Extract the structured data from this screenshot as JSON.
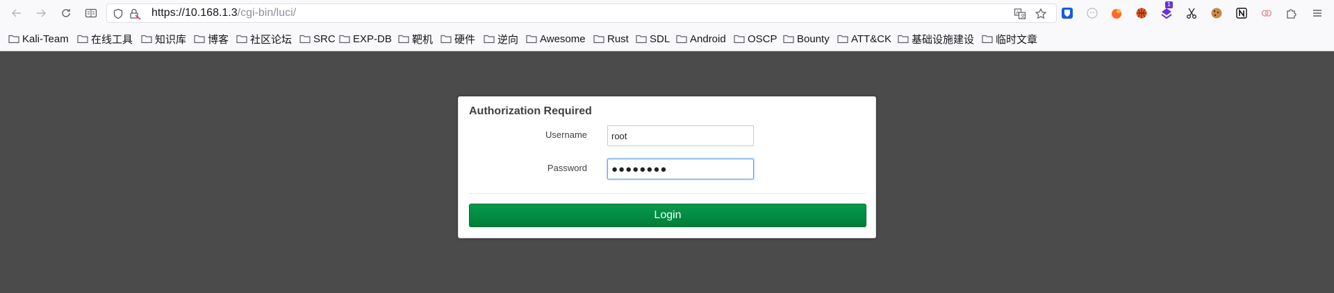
{
  "browser": {
    "url_host": "https://10.168.1.3",
    "url_path": "/cgi-bin/luci/",
    "extensions": [
      "bitwarden-icon",
      "ghost-extension-icon",
      "orange-extension-icon",
      "basketball-extension-icon",
      "pocket-extension-icon",
      "scissors-icon",
      "cookie-icon",
      "notion-icon",
      "link-extension-icon",
      "extensions-puzzle-icon",
      "menu-icon"
    ],
    "extension_badge": "1"
  },
  "bookmarks": [
    "Kali-Team",
    "在线工具",
    "知识库",
    "博客",
    "社区论坛",
    "SRC",
    "EXP-DB",
    "靶机",
    "硬件",
    "逆向",
    "Awesome",
    "Rust",
    "SDL",
    "Android",
    "OSCP",
    "Bounty",
    "ATT&CK",
    "基础设施建设",
    "临时文章"
  ],
  "login": {
    "title": "Authorization Required",
    "username_label": "Username",
    "username_value": "root",
    "password_label": "Password",
    "password_value": "●●●●●●●●",
    "button_label": "Login"
  },
  "colors": {
    "page_background": "#4b4b4b",
    "login_button": "#008a40"
  }
}
